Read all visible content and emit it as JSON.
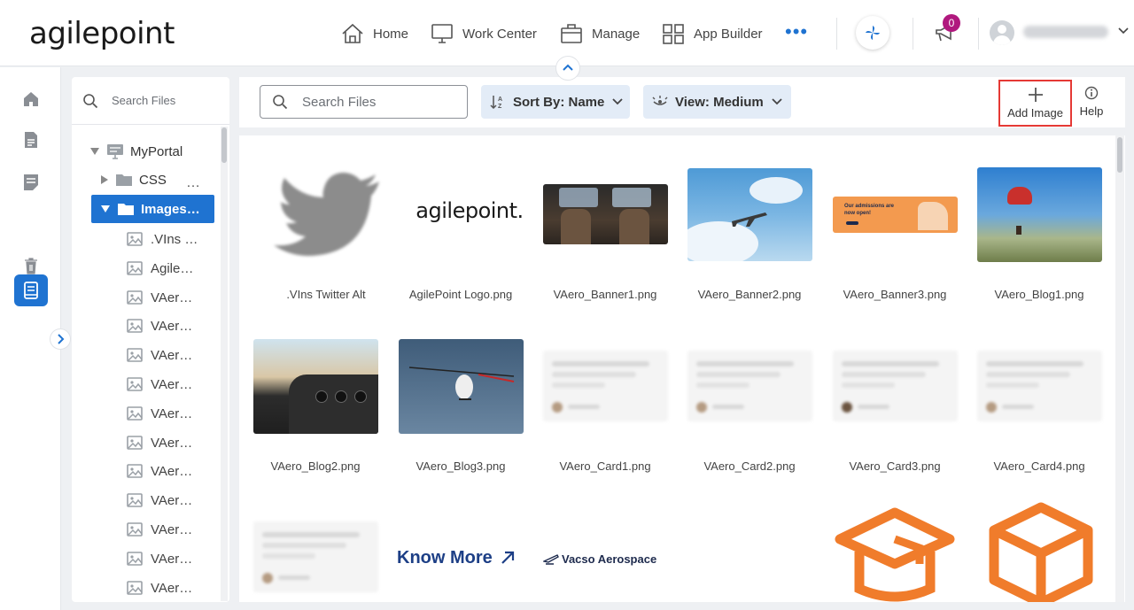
{
  "header": {
    "logo_text": "agilepoint",
    "nav": {
      "home": "Home",
      "work_center": "Work Center",
      "manage": "Manage",
      "app_builder": "App Builder",
      "more": "•••"
    },
    "notification_count": "0"
  },
  "tree": {
    "search_placeholder": "Search Files",
    "root": "MyPortal",
    "folders": [
      "CSS",
      "Images…"
    ],
    "more_label": "…",
    "files": [
      ".VIns …",
      "Agile…",
      "VAer…",
      "VAer…",
      "VAer…",
      "VAer…",
      "VAer…",
      "VAer…",
      "VAer…",
      "VAer…",
      "VAer…",
      "VAer…",
      "VAer…"
    ]
  },
  "toolbar": {
    "search_placeholder": "Search Files",
    "sort_label": "Sort By: Name",
    "view_label": "View: Medium",
    "add_image_label": "Add Image",
    "help_label": "Help"
  },
  "grid": {
    "items": [
      ".VIns Twitter Alt",
      "AgilePoint Logo.png",
      "VAero_Banner1.png",
      "VAero_Banner2.png",
      "VAero_Banner3.png",
      "VAero_Blog1.png",
      "VAero_Blog2.png",
      "VAero_Blog3.png",
      "VAero_Card1.png",
      "VAero_Card2.png",
      "VAero_Card3.png",
      "VAero_Card4.png"
    ],
    "thumb_texts": {
      "agilepoint_logo": "agilepoint.",
      "banner3_line": "Our admissions are now open!",
      "know_more": "Know More",
      "vasco": "Vacso Aerospace"
    }
  },
  "colors": {
    "accent": "#1f73d1",
    "badge": "#b0187e",
    "highlight_border": "#e53935",
    "orange_icon": "#f07c2b"
  }
}
